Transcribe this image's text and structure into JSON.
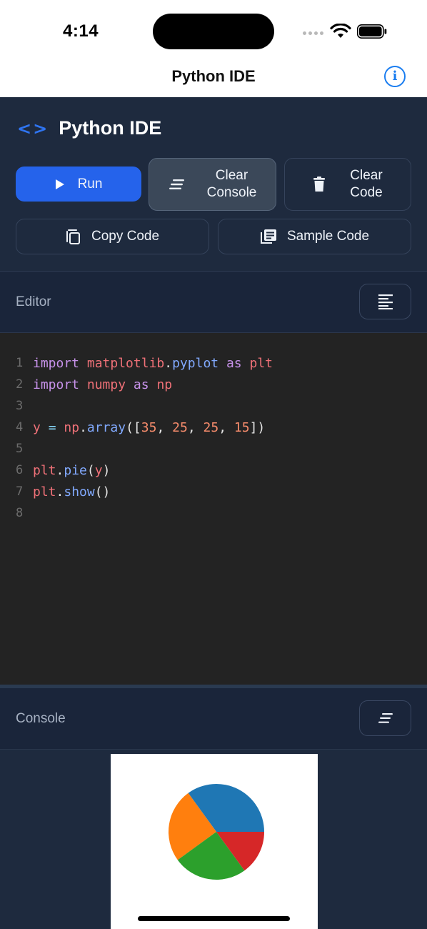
{
  "status_bar": {
    "time": "4:14"
  },
  "nav": {
    "title": "Python IDE"
  },
  "header": {
    "brand_title": "Python IDE",
    "buttons": {
      "run": "Run",
      "clear_console_1": "Clear",
      "clear_console_2": "Console",
      "clear_code_1": "Clear",
      "clear_code_2": "Code",
      "copy_code": "Copy Code",
      "sample_code": "Sample Code"
    }
  },
  "editor": {
    "label": "Editor",
    "lines": [
      {
        "n": "1",
        "tokens": [
          {
            "t": "import",
            "c": "kw"
          },
          {
            "t": " ",
            "c": "pn"
          },
          {
            "t": "matplotlib",
            "c": "id"
          },
          {
            "t": ".",
            "c": "pn"
          },
          {
            "t": "pyplot",
            "c": "fn"
          },
          {
            "t": " ",
            "c": "pn"
          },
          {
            "t": "as",
            "c": "kw"
          },
          {
            "t": " ",
            "c": "pn"
          },
          {
            "t": "plt",
            "c": "id"
          }
        ]
      },
      {
        "n": "2",
        "tokens": [
          {
            "t": "import",
            "c": "kw"
          },
          {
            "t": " ",
            "c": "pn"
          },
          {
            "t": "numpy",
            "c": "id"
          },
          {
            "t": " ",
            "c": "pn"
          },
          {
            "t": "as",
            "c": "kw"
          },
          {
            "t": " ",
            "c": "pn"
          },
          {
            "t": "np",
            "c": "id"
          }
        ]
      },
      {
        "n": "3",
        "tokens": []
      },
      {
        "n": "4",
        "tokens": [
          {
            "t": "y",
            "c": "id"
          },
          {
            "t": " ",
            "c": "pn"
          },
          {
            "t": "=",
            "c": "op"
          },
          {
            "t": " ",
            "c": "pn"
          },
          {
            "t": "np",
            "c": "id"
          },
          {
            "t": ".",
            "c": "pn"
          },
          {
            "t": "array",
            "c": "fn"
          },
          {
            "t": "([",
            "c": "pn"
          },
          {
            "t": "35",
            "c": "num"
          },
          {
            "t": ", ",
            "c": "pn"
          },
          {
            "t": "25",
            "c": "num"
          },
          {
            "t": ", ",
            "c": "pn"
          },
          {
            "t": "25",
            "c": "num"
          },
          {
            "t": ", ",
            "c": "pn"
          },
          {
            "t": "15",
            "c": "num"
          },
          {
            "t": "])",
            "c": "pn"
          }
        ]
      },
      {
        "n": "5",
        "tokens": []
      },
      {
        "n": "6",
        "tokens": [
          {
            "t": "plt",
            "c": "id"
          },
          {
            "t": ".",
            "c": "pn"
          },
          {
            "t": "pie",
            "c": "fn"
          },
          {
            "t": "(",
            "c": "pn"
          },
          {
            "t": "y",
            "c": "id"
          },
          {
            "t": ")",
            "c": "pn"
          }
        ]
      },
      {
        "n": "7",
        "tokens": [
          {
            "t": "plt",
            "c": "id"
          },
          {
            "t": ".",
            "c": "pn"
          },
          {
            "t": "show",
            "c": "fn"
          },
          {
            "t": "()",
            "c": "pn"
          }
        ]
      },
      {
        "n": "8",
        "tokens": []
      }
    ]
  },
  "console": {
    "label": "Console",
    "chart_data": {
      "type": "pie",
      "values": [
        35,
        25,
        25,
        15
      ],
      "colors": [
        "#1f77b4",
        "#ff7f0e",
        "#2ca02c",
        "#d62728"
      ],
      "start_angle_deg": 0,
      "direction": "counterclockwise"
    }
  },
  "colors": {
    "accent": "#2563eb",
    "bg": "#1e2a3e",
    "editor_bg": "#232323",
    "link": "#1a7df0"
  }
}
